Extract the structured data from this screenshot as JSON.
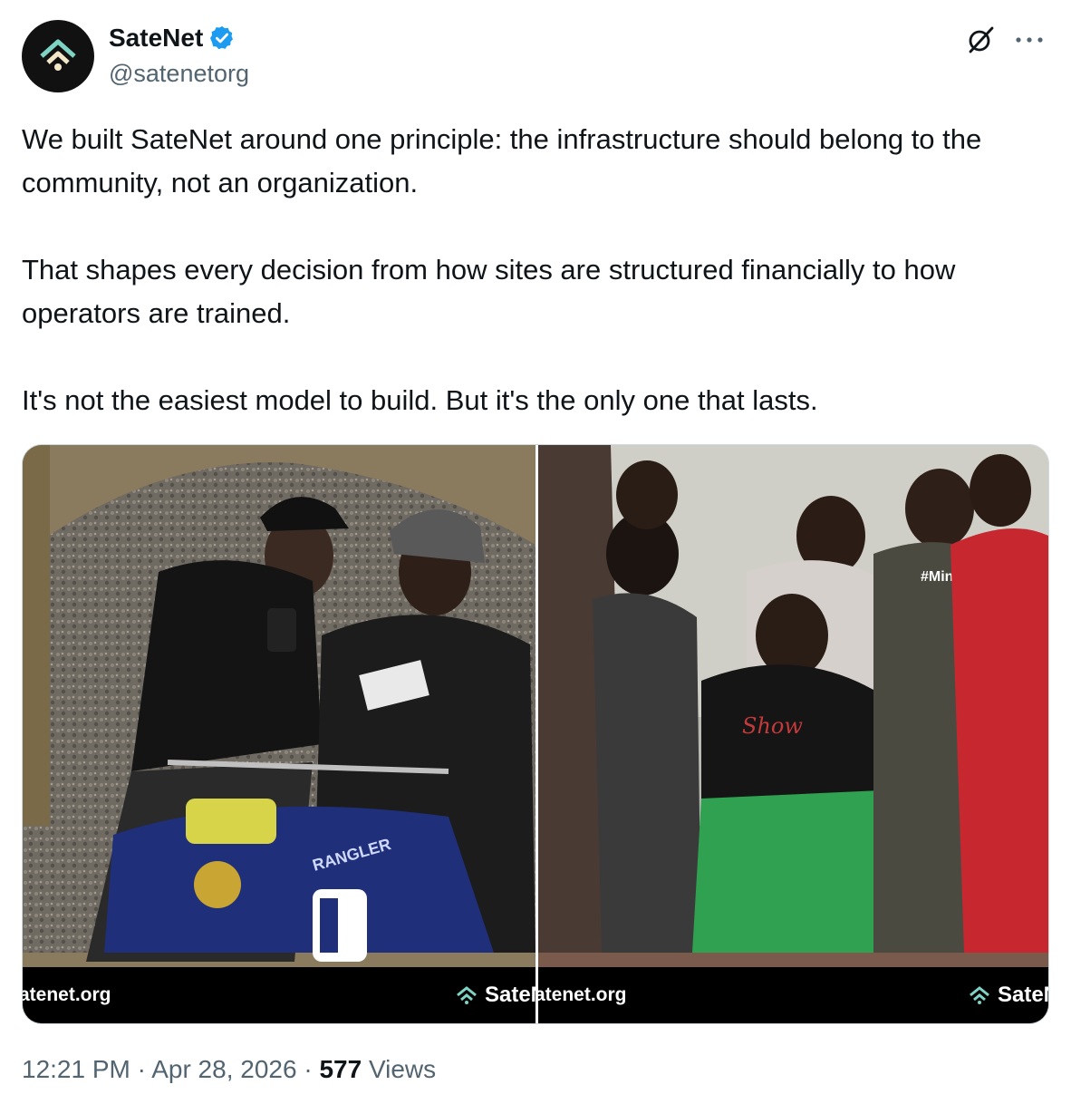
{
  "author": {
    "display_name": "SateNet",
    "handle": "@satenetorg",
    "verified": true,
    "avatar_icon": "satenet-logo-icon"
  },
  "actions": {
    "grok_icon": "grok-icon",
    "more_icon": "more-horizontal-icon"
  },
  "tweet": {
    "paragraphs": [
      "We built SateNet around one principle: the infrastructure should belong to the community, not an organization.",
      "That shapes every decision from how sites are structured financially to how operators are trained.",
      "It's not the easiest model to build. But it's the only one that lasts."
    ]
  },
  "media": {
    "photos": [
      {
        "caption_left": "atenet.org",
        "caption_right": "SateN",
        "shirt_text": "",
        "bike_text": "RANGLER"
      },
      {
        "caption_left": "atenet.org",
        "caption_right": "SateN",
        "shirt_text": "#Minds",
        "hoodie_text": "Show"
      }
    ]
  },
  "meta": {
    "time": "12:21 PM",
    "separator": "·",
    "date": "Apr 28, 2026",
    "views_count": "577",
    "views_label": "Views"
  },
  "colors": {
    "verified_blue": "#1d9bf0",
    "logo_teal": "#7fd3c4",
    "text_primary": "#0f1419",
    "text_secondary": "#536471"
  }
}
